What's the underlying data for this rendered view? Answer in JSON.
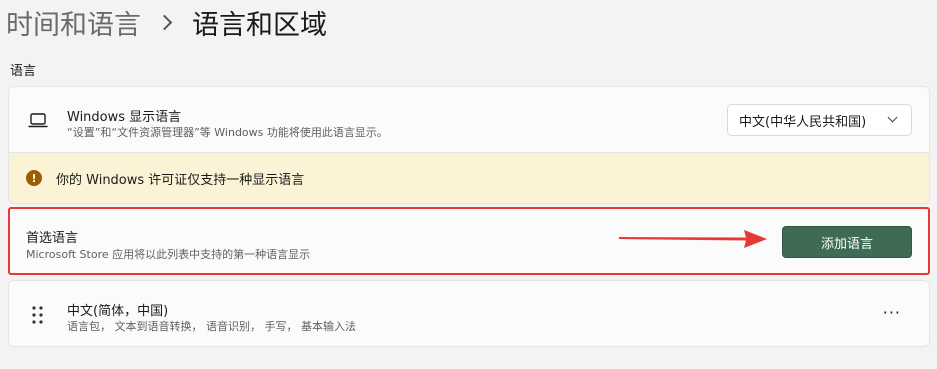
{
  "breadcrumb": {
    "parent": "时间和语言",
    "current": "语言和区域"
  },
  "section": {
    "label": "语言"
  },
  "display_language": {
    "icon": "laptop-icon",
    "title": "Windows 显示语言",
    "subtitle": "“设置”和“文件资源管理器”等 Windows 功能将使用此语言显示。",
    "selected_value": "中文(中华人民共和国)"
  },
  "warning": {
    "icon": "warning-icon",
    "icon_glyph": "!",
    "text": "你的 Windows 许可证仅支持一种显示语言"
  },
  "preferred": {
    "title": "首选语言",
    "subtitle": "Microsoft Store 应用将以此列表中支持的第一种语言显示",
    "add_button_label": "添加语言"
  },
  "languages": [
    {
      "name": "中文(简体，中国)",
      "features": "语言包， 文本到语音转换， 语音识别， 手写， 基本输入法",
      "more_label": "···"
    }
  ],
  "colors": {
    "accent_button": "#3f6b55",
    "highlight_border": "#e53935",
    "warning_bg": "#fcf3d6",
    "warning_icon": "#9d5d00"
  }
}
